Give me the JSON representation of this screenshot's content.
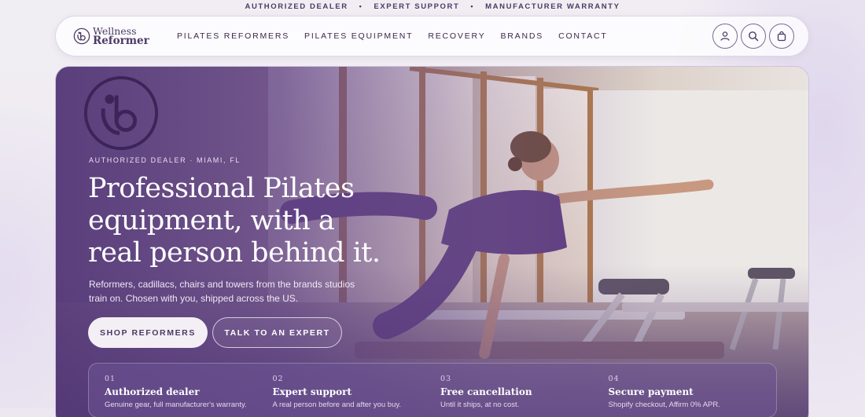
{
  "announcement": {
    "items": [
      "AUTHORIZED DEALER",
      "EXPERT SUPPORT",
      "MANUFACTURER WARRANTY"
    ],
    "separator": "•"
  },
  "header": {
    "logo": {
      "line1": "Wellness",
      "line2": "Reformer"
    },
    "nav": [
      "PILATES REFORMERS",
      "PILATES EQUIPMENT",
      "RECOVERY",
      "BRANDS",
      "CONTACT"
    ],
    "icons": [
      "account-icon",
      "search-icon",
      "cart-icon"
    ]
  },
  "hero": {
    "eyebrow": "AUTHORIZED DEALER · MIAMI, FL",
    "headline_lines": [
      "Professional Pilates",
      "equipment, with a",
      "real person behind it."
    ],
    "subtext": "Reformers, cadillacs, chairs and towers from the brands studios train on. Chosen with you, shipped across the US.",
    "primary_cta": "SHOP REFORMERS",
    "secondary_cta": "TALK TO AN EXPERT"
  },
  "features": [
    {
      "num": "01",
      "title": "Authorized dealer",
      "desc": "Genuine gear, full manufacturer's warranty."
    },
    {
      "num": "02",
      "title": "Expert support",
      "desc": "A real person before and after you buy."
    },
    {
      "num": "03",
      "title": "Free cancellation",
      "desc": "Until it ships, at no cost."
    },
    {
      "num": "04",
      "title": "Secure payment",
      "desc": "Shopify checkout, Affirm 0% APR."
    }
  ],
  "colors": {
    "brand": "#4b3a66",
    "hero_overlay": "#563a7a",
    "button_light": "#f4eff4",
    "text_light": "#ffffff"
  }
}
